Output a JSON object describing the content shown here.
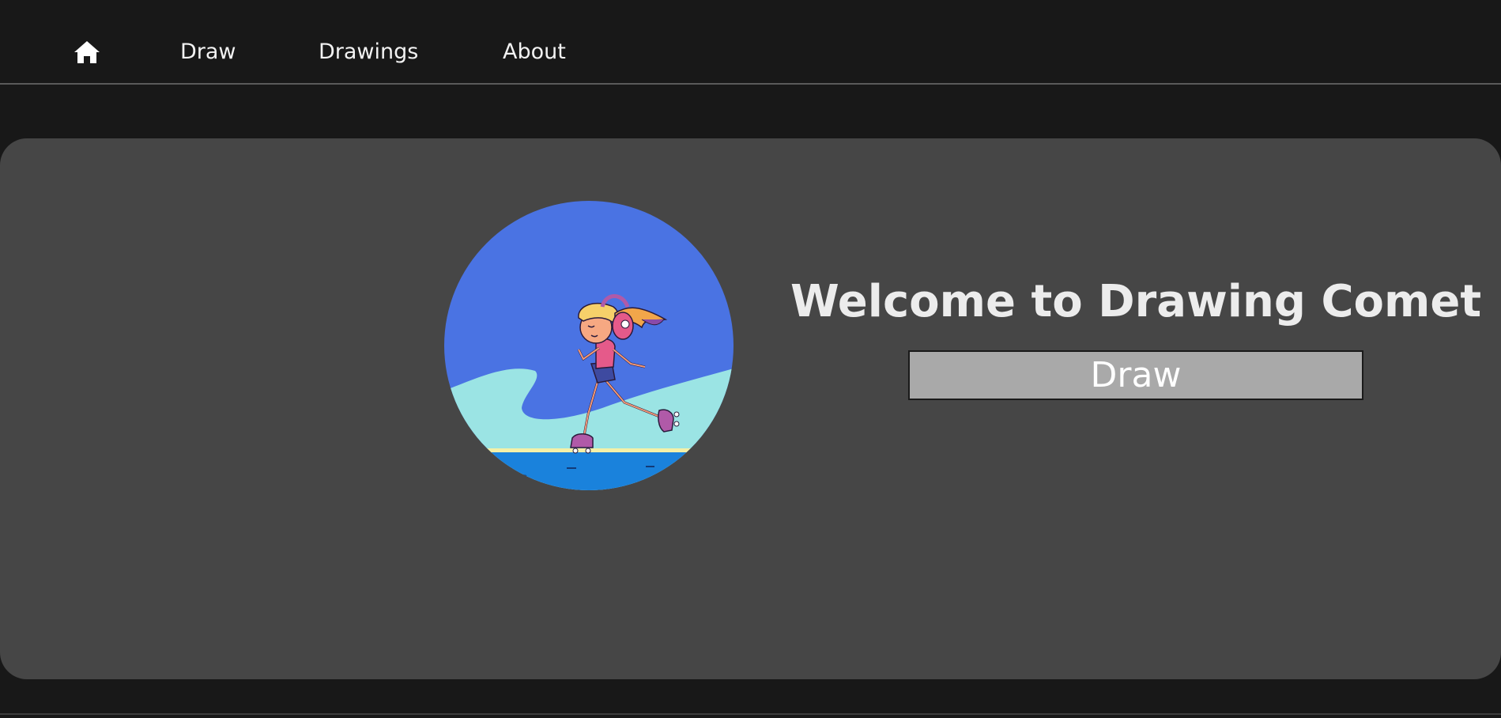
{
  "nav": {
    "home_icon": "home-icon",
    "items": [
      {
        "label": "Draw"
      },
      {
        "label": "Drawings"
      },
      {
        "label": "About"
      }
    ]
  },
  "hero": {
    "title": "Welcome to Drawing Comet",
    "button_label": "Draw",
    "illustration": "roller-skater-illustration"
  },
  "colors": {
    "page_background": "#181818",
    "card_background": "#464646",
    "button_background": "#a9a9a9",
    "sky": "#4a73e3",
    "hill": "#9be4e4",
    "water": "#1a82dc"
  }
}
